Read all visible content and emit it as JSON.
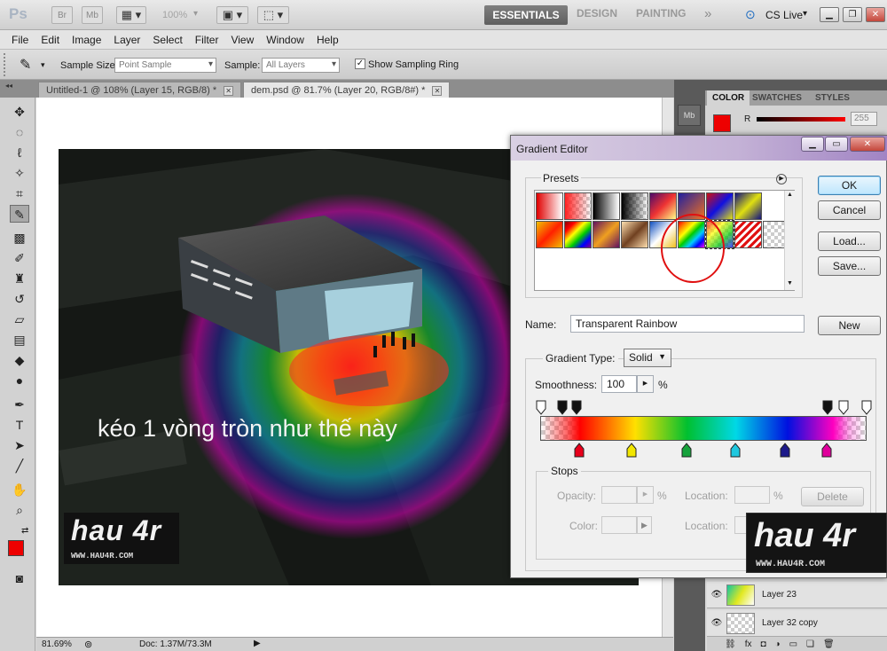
{
  "app": {
    "logo": "Ps",
    "top_buttons": [
      "Br",
      "Mb"
    ],
    "zoom_level": "100%",
    "workspaces": [
      "ESSENTIALS",
      "DESIGN",
      "PAINTING"
    ],
    "cs_live": "CS Live"
  },
  "menu": [
    "File",
    "Edit",
    "Image",
    "Layer",
    "Select",
    "Filter",
    "View",
    "Window",
    "Help"
  ],
  "options_bar": {
    "sample_size_label": "Sample Size:",
    "sample_size_value": "Point Sample",
    "sample_label": "Sample:",
    "sample_value": "All Layers",
    "show_ring_label": "Show Sampling Ring"
  },
  "doc_tabs": [
    {
      "title": "Untitled-1 @ 108% (Layer 15, RGB/8) *"
    },
    {
      "title": "dem.psd @ 81.7% (Layer 20, RGB/8#) *"
    }
  ],
  "canvas": {
    "caption": "kéo 1 vòng tròn như thế này",
    "logo_text": "hau 4r",
    "logo_url": "WWW.HAU4R.COM"
  },
  "status": {
    "zoom": "81.69%",
    "doc": "Doc: 1.37M/73.3M"
  },
  "panels": {
    "tabs": [
      "COLOR",
      "SWATCHES",
      "STYLES"
    ],
    "r_label": "R",
    "r_value": "255",
    "foreground_color": "#ee0000",
    "layers": [
      {
        "name": "Layer 23"
      },
      {
        "name": "Layer 32 copy"
      }
    ],
    "watermark_logo": "hau 4r",
    "watermark_url": "WWW.HAU4R.COM"
  },
  "gradient_editor": {
    "title": "Gradient Editor",
    "presets_label": "Presets",
    "ok": "OK",
    "cancel": "Cancel",
    "load": "Load...",
    "save": "Save...",
    "name_label": "Name:",
    "name_value": "Transparent Rainbow",
    "new": "New",
    "type_label": "Gradient Type:",
    "type_value": "Solid",
    "smooth_label": "Smoothness:",
    "smooth_value": "100",
    "pct": "%",
    "stops_label": "Stops",
    "opacity_label": "Opacity:",
    "color_label": "Color:",
    "location_label": "Location:",
    "delete": "Delete",
    "color_stops": [
      "#e8001b",
      "#f2e600",
      "#16a23c",
      "#20c8df",
      "#1d1a8a",
      "#e0009c"
    ]
  }
}
